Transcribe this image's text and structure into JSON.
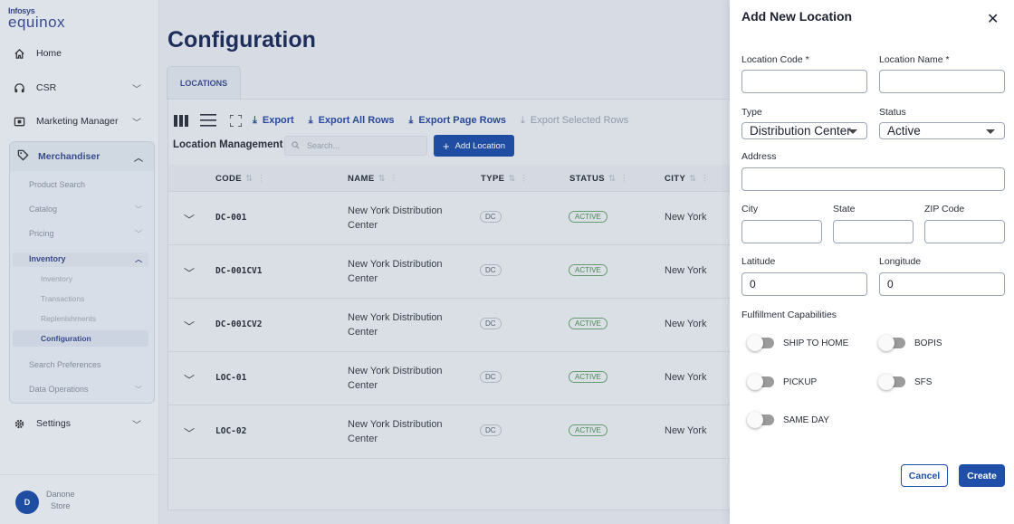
{
  "brand": {
    "line1": "Infosys",
    "line2": "equinox"
  },
  "sidebar": {
    "items": [
      {
        "label": "Home",
        "icon": "home-icon"
      },
      {
        "label": "CSR",
        "icon": "headset-icon"
      },
      {
        "label": "Marketing Manager",
        "icon": "marketing-icon"
      },
      {
        "label": "Merchandiser",
        "icon": "tag-icon"
      },
      {
        "label": "Settings",
        "icon": "gear-icon"
      }
    ],
    "merch_sub": [
      "Product Search",
      "Catalog",
      "Pricing",
      "Inventory",
      "Search Preferences",
      "Data Operations"
    ],
    "inventory_sub": [
      "Inventory",
      "Transactions",
      "Replenishments",
      "Configuration"
    ],
    "user": {
      "initial": "D",
      "name1": "Danone",
      "name2": "Store"
    }
  },
  "main": {
    "title": "Configuration",
    "tab": "LOCATIONS",
    "toolbar": {
      "export": "Export",
      "export_all": "Export All Rows",
      "export_page": "Export Page Rows",
      "export_selected": "Export Selected Rows"
    },
    "section_title": "Location Management",
    "search_placeholder": "Search...",
    "add_button": "Add Location",
    "columns": [
      "CODE",
      "NAME",
      "TYPE",
      "STATUS",
      "CITY"
    ],
    "rows": [
      {
        "code": "DC-001",
        "name": "New York Distribution Center",
        "type": "DC",
        "status": "ACTIVE",
        "city": "New York"
      },
      {
        "code": "DC-001CV1",
        "name": "New York Distribution Center",
        "type": "DC",
        "status": "ACTIVE",
        "city": "New York"
      },
      {
        "code": "DC-001CV2",
        "name": "New York Distribution Center",
        "type": "DC",
        "status": "ACTIVE",
        "city": "New York"
      },
      {
        "code": "LOC-01",
        "name": "New York Distribution Center",
        "type": "DC",
        "status": "ACTIVE",
        "city": "New York"
      },
      {
        "code": "LOC-02",
        "name": "New York Distribution Center",
        "type": "DC",
        "status": "ACTIVE",
        "city": "New York"
      }
    ]
  },
  "drawer": {
    "title": "Add New Location",
    "location_code_label": "Location Code *",
    "location_name_label": "Location Name *",
    "type_label": "Type",
    "type_value": "Distribution Center",
    "status_label": "Status",
    "status_value": "Active",
    "address_label": "Address",
    "city_label": "City",
    "state_label": "State",
    "zip_label": "ZIP Code",
    "latitude_label": "Latitude",
    "latitude_value": "0",
    "longitude_label": "Longitude",
    "longitude_value": "0",
    "capabilities_label": "Fulfillment Capabilities",
    "capabilities": [
      "SHIP TO HOME",
      "BOPIS",
      "PICKUP",
      "SFS",
      "SAME DAY"
    ],
    "cancel": "Cancel",
    "create": "Create"
  },
  "colors": {
    "primary": "#1f4fa8",
    "title": "#1e2d5c",
    "active_status": "#4c8c52"
  }
}
